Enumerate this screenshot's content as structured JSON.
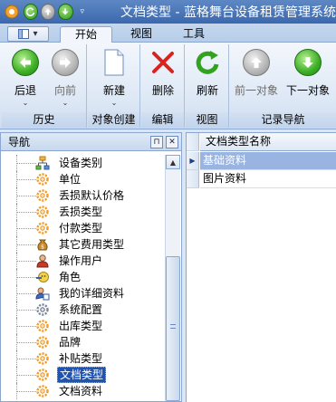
{
  "window": {
    "title": "文档类型 - 蓝格舞台设备租赁管理系统",
    "app_icon": "gear-app-icon",
    "quick_access": [
      "refresh-icon",
      "up-circle-icon",
      "down-circle-icon",
      "dropdown-icon"
    ]
  },
  "tabs": {
    "items": [
      {
        "label": "开始",
        "active": true
      },
      {
        "label": "视图",
        "active": false
      },
      {
        "label": "工具",
        "active": false
      }
    ]
  },
  "ribbon": {
    "groups": [
      {
        "label": "历史",
        "buttons": [
          {
            "label": "后退",
            "icon": "back-arrow-icon",
            "enabled": true,
            "has_dropdown": true
          },
          {
            "label": "向前",
            "icon": "forward-arrow-icon",
            "enabled": false,
            "has_dropdown": true
          }
        ]
      },
      {
        "label": "对象创建",
        "buttons": [
          {
            "label": "新建",
            "icon": "new-document-icon",
            "enabled": true,
            "has_dropdown": true
          }
        ]
      },
      {
        "label": "编辑",
        "buttons": [
          {
            "label": "删除",
            "icon": "delete-x-icon",
            "enabled": true,
            "has_dropdown": false
          }
        ]
      },
      {
        "label": "视图",
        "buttons": [
          {
            "label": "刷新",
            "icon": "refresh-icon",
            "enabled": true,
            "has_dropdown": false
          }
        ]
      },
      {
        "label": "记录导航",
        "buttons": [
          {
            "label": "前一对象",
            "icon": "up-arrow-icon",
            "enabled": false,
            "has_dropdown": false
          },
          {
            "label": "下一对象",
            "icon": "down-arrow-icon",
            "enabled": true,
            "has_dropdown": false
          }
        ]
      }
    ]
  },
  "nav": {
    "title": "导航",
    "items": [
      {
        "label": "设备类别",
        "icon": "category-tree-icon"
      },
      {
        "label": "单位",
        "icon": "gear-icon"
      },
      {
        "label": "丢损默认价格",
        "icon": "gear-icon"
      },
      {
        "label": "丢损类型",
        "icon": "gear-icon"
      },
      {
        "label": "付款类型",
        "icon": "gear-icon"
      },
      {
        "label": "其它费用类型",
        "icon": "money-bag-icon"
      },
      {
        "label": "操作用户",
        "icon": "user-icon"
      },
      {
        "label": "角色",
        "icon": "role-icon"
      },
      {
        "label": "我的详细资料",
        "icon": "user-detail-icon"
      },
      {
        "label": "系统配置",
        "icon": "config-gear-icon"
      },
      {
        "label": "出库类型",
        "icon": "gear-icon"
      },
      {
        "label": "品牌",
        "icon": "gear-icon"
      },
      {
        "label": "补贴类型",
        "icon": "gear-icon"
      },
      {
        "label": "文档类型",
        "icon": "gear-icon",
        "selected": true
      },
      {
        "label": "文档资料",
        "icon": "gear-icon"
      }
    ]
  },
  "grid": {
    "column_header": "文档类型名称",
    "rows": [
      {
        "name": "基础资料",
        "selected": true
      },
      {
        "name": "图片资料",
        "selected": false
      }
    ]
  },
  "colors": {
    "title_bar": "#4a78bb",
    "selection": "#1e53b2",
    "grid_selection": "#99b4e1"
  }
}
